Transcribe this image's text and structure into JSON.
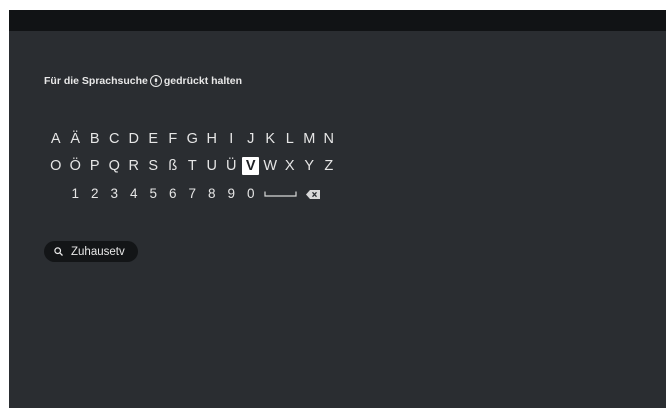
{
  "search_hint": {
    "before": "Für die Sprachsuche",
    "icon": "microphone-icon",
    "after": "gedrückt halten"
  },
  "keyboard": {
    "row1": [
      "A",
      "Ä",
      "B",
      "C",
      "D",
      "E",
      "F",
      "G",
      "H",
      "I",
      "J",
      "K",
      "L",
      "M",
      "N"
    ],
    "row2": [
      "O",
      "Ö",
      "P",
      "Q",
      "R",
      "S",
      "ß",
      "T",
      "U",
      "Ü",
      "V",
      "W",
      "X",
      "Y",
      "Z"
    ],
    "row3": [
      "1",
      "2",
      "3",
      "4",
      "5",
      "6",
      "7",
      "8",
      "9",
      "0"
    ],
    "space_icon": "space-bar-icon",
    "backspace_icon": "backspace-icon",
    "selected_key": "V"
  },
  "suggestion": {
    "icon": "search-icon",
    "text": "Zuhausetv"
  },
  "colors": {
    "background": "#2a2d31",
    "top_bar": "#111315",
    "selected_key_bg": "#ffffff",
    "pill_bg": "#131517"
  }
}
